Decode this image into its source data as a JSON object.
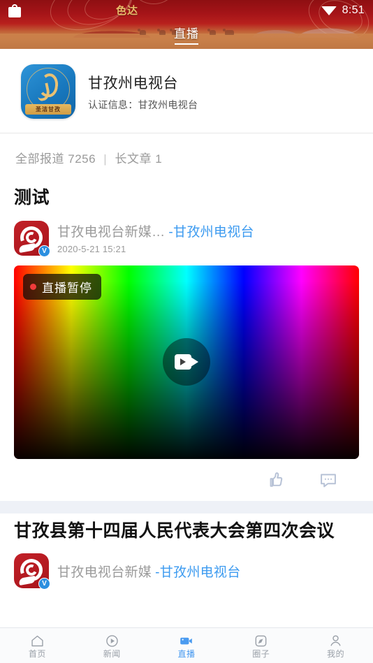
{
  "status_bar": {
    "left_icon": "shopping-bag-icon",
    "wifi_icon": "wifi-icon",
    "time": "8:51"
  },
  "banner": {
    "tab_label": "直播",
    "decorative_text": "色达",
    "bg_color": "#a51418"
  },
  "profile": {
    "avatar_icon": "ganzi-tv-logo",
    "avatar_badge_text": "圣洁甘孜",
    "name": "甘孜州电视台",
    "verify_info": "认证信息：甘孜州电视台"
  },
  "stats": {
    "reports_label": "全部报道",
    "reports_count": "7256",
    "separator": "|",
    "articles_label": "长文章",
    "articles_count": "1"
  },
  "articles": [
    {
      "title": "测试",
      "author_avatar": "ganzi-spiral-avatar",
      "verified_badge": "V",
      "author_name": "甘孜电视台新媒…",
      "source": "-甘孜州电视台",
      "date": "2020-5-21 15:21",
      "video": {
        "live_status": "直播暂停",
        "play_icon": "video-camera-icon",
        "status_dot_color": "#f03b3b"
      },
      "actions": {
        "like_icon": "thumbs-up-icon",
        "comment_icon": "comment-bubble-icon"
      }
    },
    {
      "title": "甘孜县第十四届人民代表大会第四次会议",
      "author_avatar": "ganzi-spiral-avatar",
      "verified_badge": "V",
      "author_name": "甘孜电视台新媒",
      "source": "-甘孜州电视台",
      "date": ""
    }
  ],
  "bottom_nav": {
    "active_color": "#4a9bf0",
    "items": [
      {
        "label": "首页",
        "icon": "home-icon",
        "active": false
      },
      {
        "label": "新闻",
        "icon": "play-circle-icon",
        "active": false
      },
      {
        "label": "直播",
        "icon": "video-camera-icon",
        "active": true
      },
      {
        "label": "圈子",
        "icon": "compass-icon",
        "active": false
      },
      {
        "label": "我的",
        "icon": "person-icon",
        "active": false
      }
    ]
  }
}
